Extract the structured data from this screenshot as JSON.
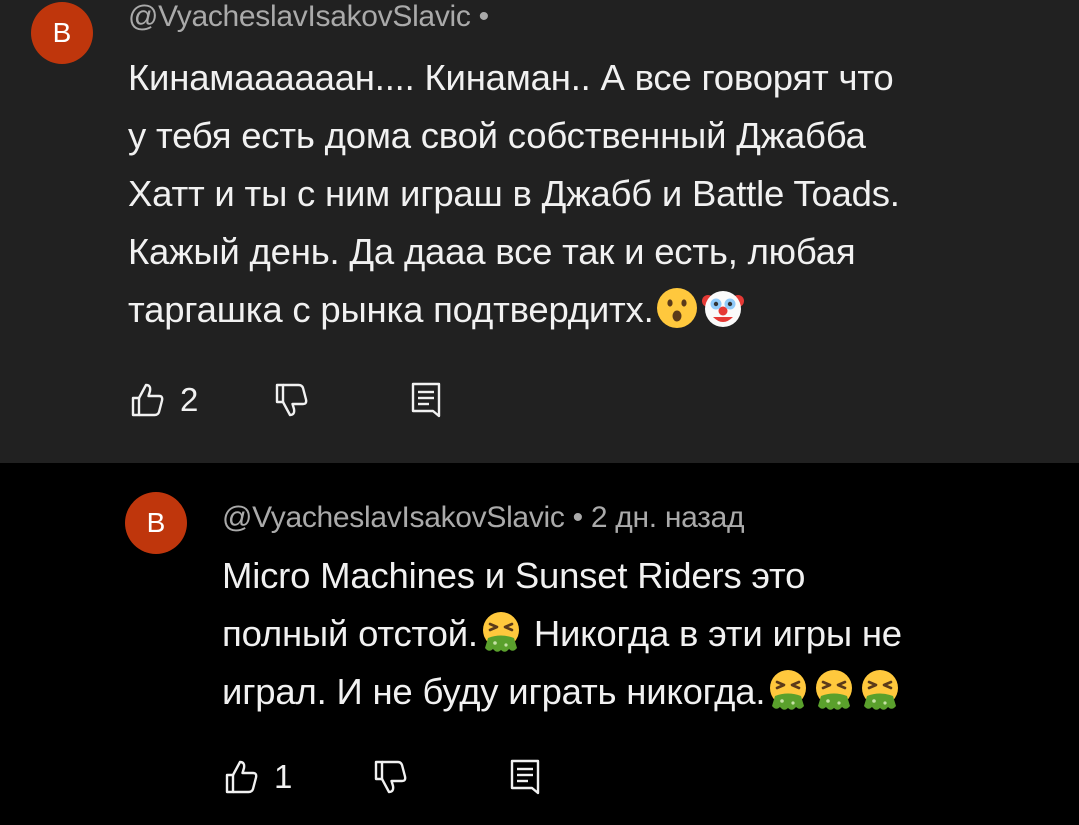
{
  "comment": {
    "avatar_letter": "В",
    "author": "@VyacheslavIsakovSlavic",
    "separator": "•",
    "lines": [
      "Кинамаааааан.... Кинаман.. А все говорят что",
      "у тебя есть дома свой собственный Джабба",
      "Хатт и ты с ним играш в Джабб и Battle Toads.",
      "Кажый день. Да дааа все так и есть, любая",
      "таргашка с рынка подтвердитх."
    ],
    "trailing_emojis": [
      "hushed-face-emoji",
      "clown-face-emoji"
    ],
    "like_count": "2"
  },
  "reply": {
    "avatar_letter": "В",
    "author": "@VyacheslavIsakovSlavic",
    "separator": "•",
    "timestamp": "2 дн. назад",
    "line1": "Micro Machines и Sunset Riders это",
    "line2_before": "полный отстой.",
    "line2_after": " Никогда в эти игры не",
    "line3": "играл. И не буду играть никогда.",
    "emojis": [
      "vomiting-face-emoji",
      "vomiting-face-emoji",
      "vomiting-face-emoji",
      "vomiting-face-emoji"
    ],
    "like_count": "1"
  },
  "colors": {
    "top_background": "#212121",
    "reply_background": "#000000",
    "avatar": "#bf360c",
    "meta_text": "#aaaaaa",
    "body_text": "#f1f1f1"
  }
}
